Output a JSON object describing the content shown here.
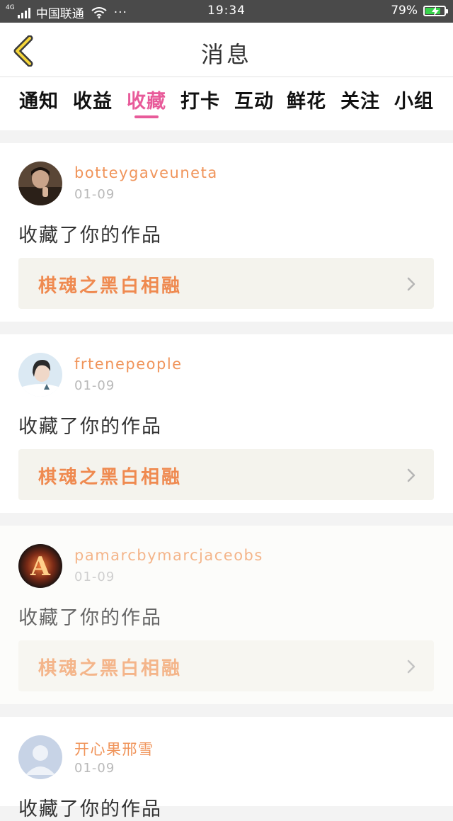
{
  "status_bar": {
    "network": "4G",
    "carrier": "中国联通",
    "more": "···",
    "time": "19:34",
    "battery_text": "79%",
    "battery_level": 0.79,
    "battery_color": "#38d24b"
  },
  "header": {
    "title": "消息",
    "back_icon": "chevron-left-icon"
  },
  "tabs": [
    {
      "label": "通知",
      "active": false
    },
    {
      "label": "收益",
      "active": false
    },
    {
      "label": "收藏",
      "active": true
    },
    {
      "label": "打卡",
      "active": false
    },
    {
      "label": "互动",
      "active": false
    },
    {
      "label": "鲜花",
      "active": false
    },
    {
      "label": "关注",
      "active": false
    },
    {
      "label": "小组",
      "active": false
    }
  ],
  "colors": {
    "accent": "#e85b9a",
    "username": "#f0945a",
    "work_title": "#ef8a50",
    "work_box_bg": "#f4f3ed"
  },
  "messages": [
    {
      "username": "botteygaveuneta",
      "date": "01-09",
      "action": "收藏了你的作品",
      "work_title": "棋魂之黑白相融",
      "avatar": "photo-avatar"
    },
    {
      "username": "frtenepeople",
      "date": "01-09",
      "action": "收藏了你的作品",
      "work_title": "棋魂之黑白相融",
      "avatar": "photo-avatar"
    },
    {
      "username": "pamarcbymarcjaceobs",
      "date": "01-09",
      "action": "收藏了你的作品",
      "work_title": "棋魂之黑白相融",
      "avatar": "photo-avatar"
    },
    {
      "username": "开心果邢雪",
      "date": "01-09",
      "action": "收藏了你的作品",
      "avatar": "default-user-avatar"
    }
  ]
}
